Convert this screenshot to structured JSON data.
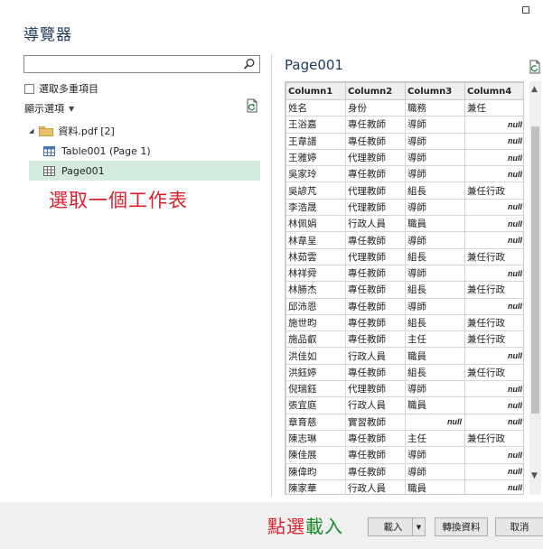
{
  "dialog": {
    "title": "導覽器"
  },
  "search": {
    "placeholder": ""
  },
  "left": {
    "multi_select_label": "選取多重項目",
    "display_options_label": "顯示選項",
    "tree": {
      "folder_label": "資料.pdf [2]",
      "table1_label": "Table001 (Page 1)",
      "page_label": "Page001"
    }
  },
  "annotations": {
    "select_sheet": "選取一個工作表",
    "click_load_part1": "點選",
    "click_load_part2": "載入"
  },
  "preview": {
    "title": "Page001",
    "columns": [
      "Column1",
      "Column2",
      "Column3",
      "Column4"
    ],
    "rows": [
      [
        "姓名",
        "身份",
        "職務",
        "兼任"
      ],
      [
        "王浴嘉",
        "專任教師",
        "導師",
        "null"
      ],
      [
        "王韋譜",
        "專任教師",
        "導師",
        "null"
      ],
      [
        "王雅婷",
        "代理教師",
        "導師",
        "null"
      ],
      [
        "吳家玲",
        "專任教師",
        "導師",
        "null"
      ],
      [
        "吳諺芃",
        "代理教師",
        "組長",
        "兼任行政"
      ],
      [
        "李浩晟",
        "代理教師",
        "導師",
        "null"
      ],
      [
        "林佩娟",
        "行政人員",
        "職員",
        "null"
      ],
      [
        "林韋呈",
        "專任教師",
        "導師",
        "null"
      ],
      [
        "林茹雲",
        "代理教師",
        "組長",
        "兼任行政"
      ],
      [
        "林祥舜",
        "專任教師",
        "導師",
        "null"
      ],
      [
        "林勝杰",
        "專任教師",
        "組長",
        "兼任行政"
      ],
      [
        "邱沛恩",
        "專任教師",
        "導師",
        "null"
      ],
      [
        "施世昀",
        "專任教師",
        "組長",
        "兼任行政"
      ],
      [
        "施品叡",
        "專任教師",
        "主任",
        "兼任行政"
      ],
      [
        "洪佳如",
        "行政人員",
        "職員",
        "null"
      ],
      [
        "洪鈺婷",
        "專任教師",
        "組長",
        "兼任行政"
      ],
      [
        "倪瑞鈺",
        "代理教師",
        "導師",
        "null"
      ],
      [
        "張宜庭",
        "行政人員",
        "職員",
        "null"
      ],
      [
        "章育慈",
        "實習教師",
        "null",
        "null"
      ],
      [
        "陳志琳",
        "專任教師",
        "主任",
        "兼任行政"
      ],
      [
        "陳佳展",
        "專任教師",
        "導師",
        "null"
      ],
      [
        "陳偉昀",
        "專任教師",
        "導師",
        "null"
      ],
      [
        "陳家華",
        "行政人員",
        "職員",
        "null"
      ]
    ]
  },
  "buttons": {
    "load": "載入",
    "transform": "轉換資料",
    "cancel": "取消"
  }
}
